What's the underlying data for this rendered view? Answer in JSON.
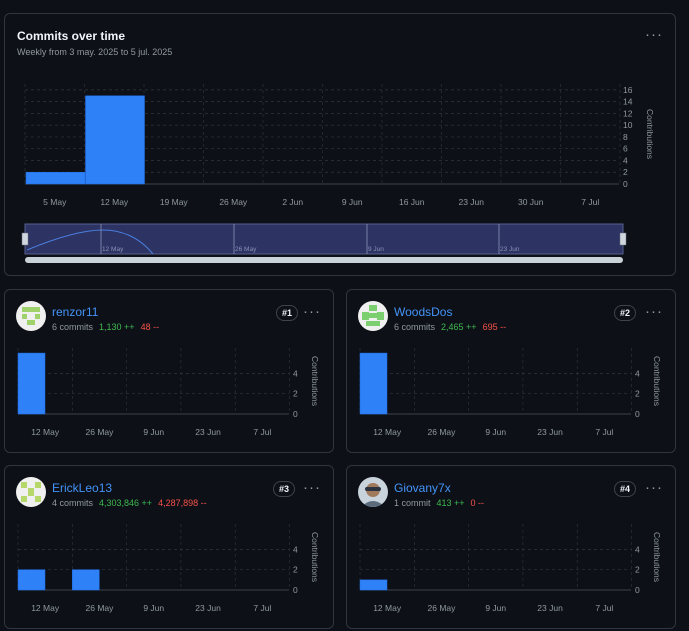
{
  "main": {
    "title": "Commits over time",
    "subtitle": "Weekly from 3 may. 2025 to 5 jul. 2025",
    "more_label": "···"
  },
  "chart_data": [
    {
      "type": "bar",
      "id": "main",
      "categories": [
        "5 May",
        "12 May",
        "19 May",
        "26 May",
        "2 Jun",
        "9 Jun",
        "16 Jun",
        "23 Jun",
        "30 Jun",
        "7 Jul"
      ],
      "values": [
        2,
        15,
        0,
        0,
        0,
        0,
        0,
        0,
        0,
        0
      ],
      "ylabel": "Contributions",
      "yticks": [
        0,
        2,
        4,
        6,
        8,
        10,
        12,
        14,
        16
      ],
      "ylim": [
        0,
        17
      ],
      "grid": true,
      "color": "#2f81f7",
      "brush_labels": [
        "12 May",
        "26 May",
        "9 Jun",
        "23 Jun"
      ]
    },
    {
      "type": "bar",
      "id": "c1",
      "categories": [
        "12 May",
        "26 May",
        "9 Jun",
        "23 Jun",
        "7 Jul"
      ],
      "values": [
        6,
        0,
        0,
        0,
        0
      ],
      "ylabel": "Contributions",
      "yticks": [
        0,
        2,
        4
      ],
      "ylim": [
        0,
        6.5
      ],
      "grid": true,
      "color": "#2f81f7"
    },
    {
      "type": "bar",
      "id": "c2",
      "categories": [
        "12 May",
        "26 May",
        "9 Jun",
        "23 Jun",
        "7 Jul"
      ],
      "values": [
        6,
        0,
        0,
        0,
        0
      ],
      "ylabel": "Contributions",
      "yticks": [
        0,
        2,
        4
      ],
      "ylim": [
        0,
        6.5
      ],
      "grid": true,
      "color": "#2f81f7"
    },
    {
      "type": "bar",
      "id": "c3",
      "categories": [
        "12 May",
        "26 May",
        "9 Jun",
        "23 Jun",
        "7 Jul"
      ],
      "values": [
        2,
        2,
        0,
        0,
        0
      ],
      "ylabel": "Contributions",
      "yticks": [
        0,
        2,
        4
      ],
      "ylim": [
        0,
        6.5
      ],
      "grid": true,
      "color": "#2f81f7"
    },
    {
      "type": "bar",
      "id": "c4",
      "categories": [
        "12 May",
        "26 May",
        "9 Jun",
        "23 Jun",
        "7 Jul"
      ],
      "values": [
        1,
        0,
        0,
        0,
        0
      ],
      "ylabel": "Contributions",
      "yticks": [
        0,
        2,
        4
      ],
      "ylim": [
        0,
        6.5
      ],
      "grid": true,
      "color": "#2f81f7"
    }
  ],
  "contributors": [
    {
      "name": "renzor11",
      "commits": "6 commits",
      "additions": "1,130 ++",
      "deletions": "48 --",
      "rank": "#1",
      "avatar": "identicon-avatar",
      "avatar_color": "#9fd26a"
    },
    {
      "name": "WoodsDos",
      "commits": "6 commits",
      "additions": "2,465 ++",
      "deletions": "695 --",
      "rank": "#2",
      "avatar": "identicon-avatar",
      "avatar_color": "#7ccf6e"
    },
    {
      "name": "ErickLeo13",
      "commits": "4 commits",
      "additions": "4,303,846 ++",
      "deletions": "4,287,898 --",
      "rank": "#3",
      "avatar": "identicon-avatar",
      "avatar_color": "#b6d76a"
    },
    {
      "name": "Giovany7x",
      "commits": "1 commit",
      "additions": "413 ++",
      "deletions": "0 --",
      "rank": "#4",
      "avatar": "photo-avatar",
      "avatar_color": "#7a8a99"
    }
  ],
  "colors": {
    "bar": "#2f81f7",
    "additions": "#3fb950",
    "deletions": "#f85149",
    "link": "#4493f8",
    "border": "#30363d",
    "background": "#0d1117"
  }
}
